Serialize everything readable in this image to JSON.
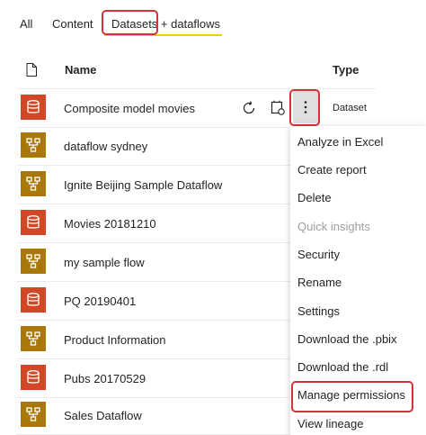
{
  "tabs": [
    {
      "label": "All"
    },
    {
      "label": "Content"
    },
    {
      "label": "Datasets + dataflows"
    }
  ],
  "columns": {
    "name": "Name",
    "type": "Type"
  },
  "rows": [
    {
      "name": "Composite model movies",
      "kind": "dataset",
      "type": "Dataset"
    },
    {
      "name": "dataflow sydney",
      "kind": "dataflow"
    },
    {
      "name": "Ignite Beijing Sample Dataflow",
      "kind": "dataflow"
    },
    {
      "name": "Movies 20181210",
      "kind": "dataset"
    },
    {
      "name": "my sample flow",
      "kind": "dataflow"
    },
    {
      "name": "PQ 20190401",
      "kind": "dataset"
    },
    {
      "name": "Product Information",
      "kind": "dataflow"
    },
    {
      "name": "Pubs 20170529",
      "kind": "dataset"
    },
    {
      "name": "Sales Dataflow",
      "kind": "dataflow"
    }
  ],
  "menu": [
    {
      "label": "Analyze in Excel",
      "disabled": false
    },
    {
      "label": "Create report",
      "disabled": false
    },
    {
      "label": "Delete",
      "disabled": false
    },
    {
      "label": "Quick insights",
      "disabled": true
    },
    {
      "label": "Security",
      "disabled": false
    },
    {
      "label": "Rename",
      "disabled": false
    },
    {
      "label": "Settings",
      "disabled": false
    },
    {
      "label": "Download the .pbix",
      "disabled": false
    },
    {
      "label": "Download the .rdl",
      "disabled": false
    },
    {
      "label": "Manage permissions",
      "disabled": false
    },
    {
      "label": "View lineage",
      "disabled": false
    }
  ],
  "icons": {
    "file": "file-icon",
    "dataset": "database-icon",
    "dataflow": "dataflow-icon",
    "refresh": "refresh-icon",
    "schedule": "scheduled-refresh-icon",
    "more": "more-options-icon"
  },
  "colors": {
    "dataset": "#d24726",
    "dataflow": "#a9780b",
    "highlight": "#d13438",
    "tab_underline": "#f2c811"
  }
}
